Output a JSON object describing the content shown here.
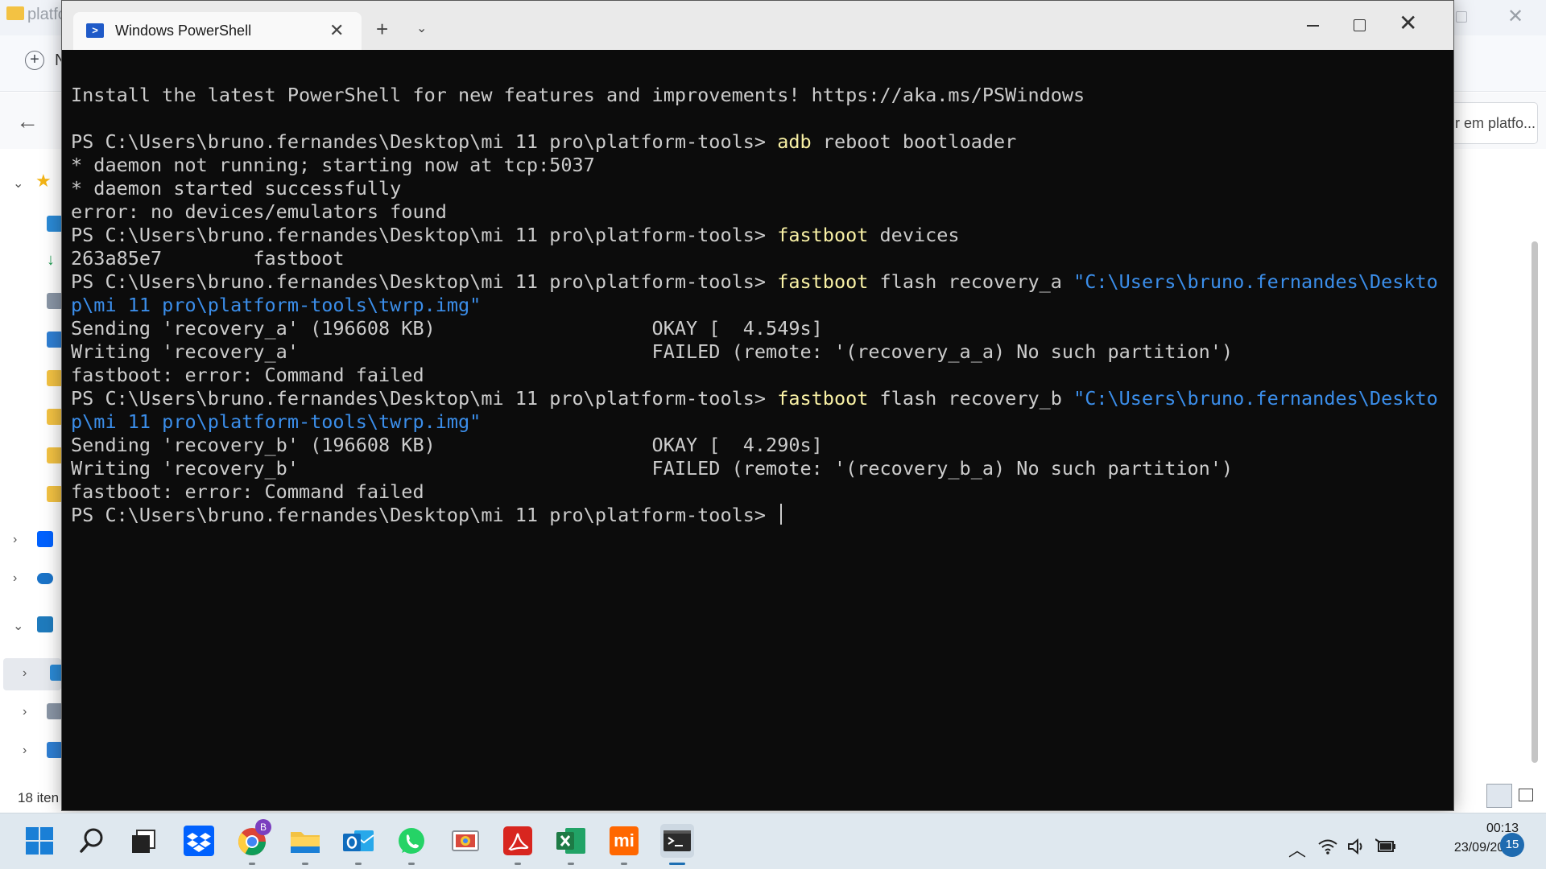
{
  "explorer": {
    "title": "platfo",
    "new_label": "N",
    "search_placeholder": "r em platfo...",
    "status": "18 iten"
  },
  "terminal": {
    "tab_title": "Windows PowerShell",
    "lines": [
      [
        {
          "t": "Install the latest PowerShell for new features and improvements! https://aka.ms/PSWindows",
          "c": ""
        }
      ],
      [
        {
          "t": "",
          "c": ""
        }
      ],
      [
        {
          "t": "PS C:\\Users\\bruno.fernandes\\Desktop\\mi 11 pro\\platform-tools> ",
          "c": ""
        },
        {
          "t": "adb",
          "c": "cmd"
        },
        {
          "t": " reboot bootloader",
          "c": ""
        }
      ],
      [
        {
          "t": "* daemon not running; starting now at tcp:5037",
          "c": ""
        }
      ],
      [
        {
          "t": "* daemon started successfully",
          "c": ""
        }
      ],
      [
        {
          "t": "error: no devices/emulators found",
          "c": ""
        }
      ],
      [
        {
          "t": "PS C:\\Users\\bruno.fernandes\\Desktop\\mi 11 pro\\platform-tools> ",
          "c": ""
        },
        {
          "t": "fastboot",
          "c": "cmd"
        },
        {
          "t": " devices",
          "c": ""
        }
      ],
      [
        {
          "t": "263a85e7        fastboot",
          "c": ""
        }
      ],
      [
        {
          "t": "PS C:\\Users\\bruno.fernandes\\Desktop\\mi 11 pro\\platform-tools> ",
          "c": ""
        },
        {
          "t": "fastboot",
          "c": "cmd"
        },
        {
          "t": " flash recovery_a ",
          "c": ""
        },
        {
          "t": "\"C:\\Users\\bruno.fernandes\\Deskto",
          "c": "str"
        }
      ],
      [
        {
          "t": "p\\mi 11 pro\\platform-tools\\twrp.img\"",
          "c": "str"
        }
      ],
      [
        {
          "t": "Sending 'recovery_a' (196608 KB)                   OKAY [  4.549s]",
          "c": ""
        }
      ],
      [
        {
          "t": "Writing 'recovery_a'                               FAILED (remote: '(recovery_a_a) No such partition')",
          "c": ""
        }
      ],
      [
        {
          "t": "fastboot: error: Command failed",
          "c": ""
        }
      ],
      [
        {
          "t": "PS C:\\Users\\bruno.fernandes\\Desktop\\mi 11 pro\\platform-tools> ",
          "c": ""
        },
        {
          "t": "fastboot",
          "c": "cmd"
        },
        {
          "t": " flash recovery_b ",
          "c": ""
        },
        {
          "t": "\"C:\\Users\\bruno.fernandes\\Deskto",
          "c": "str"
        }
      ],
      [
        {
          "t": "p\\mi 11 pro\\platform-tools\\twrp.img\"",
          "c": "str"
        }
      ],
      [
        {
          "t": "Sending 'recovery_b' (196608 KB)                   OKAY [  4.290s]",
          "c": ""
        }
      ],
      [
        {
          "t": "Writing 'recovery_b'                               FAILED (remote: '(recovery_b_a) No such partition')",
          "c": ""
        }
      ],
      [
        {
          "t": "fastboot: error: Command failed",
          "c": ""
        }
      ],
      [
        {
          "t": "PS C:\\Users\\bruno.fernandes\\Desktop\\mi 11 pro\\platform-tools> ",
          "c": ""
        }
      ]
    ]
  },
  "taskbar": {
    "apps": [
      {
        "name": "start-button",
        "icon": "windows-logo-icon",
        "color": "#1a7fd6"
      },
      {
        "name": "search-button",
        "icon": "search-icon",
        "color": "#222222"
      },
      {
        "name": "task-view-button",
        "icon": "task-view-icon",
        "color": "#222222"
      },
      {
        "name": "dropbox-button",
        "icon": "dropbox-icon",
        "color": "#0061fe"
      },
      {
        "name": "chrome-button",
        "icon": "chrome-icon",
        "color": "#4285f4"
      },
      {
        "name": "file-explorer-button",
        "icon": "folder-icon",
        "color": "#f3c243"
      },
      {
        "name": "outlook-button",
        "icon": "outlook-icon",
        "color": "#0f6cbd"
      },
      {
        "name": "whatsapp-button",
        "icon": "whatsapp-icon",
        "color": "#25d366"
      },
      {
        "name": "remote-desktop-button",
        "icon": "remote-desktop-icon",
        "color": "#5a8fc9"
      },
      {
        "name": "acrobat-button",
        "icon": "pdf-icon",
        "color": "#d8261f"
      },
      {
        "name": "excel-button",
        "icon": "excel-icon",
        "color": "#1d7a45"
      },
      {
        "name": "mi-button",
        "icon": "mi-logo-icon",
        "color": "#ff6700"
      },
      {
        "name": "terminal-button",
        "icon": "terminal-icon",
        "color": "#2b2b2b"
      }
    ],
    "chrome_badge": "B",
    "mi_label": "mi",
    "clock_time": "00:13",
    "clock_date": "23/09/2022",
    "notification_count": "15"
  }
}
